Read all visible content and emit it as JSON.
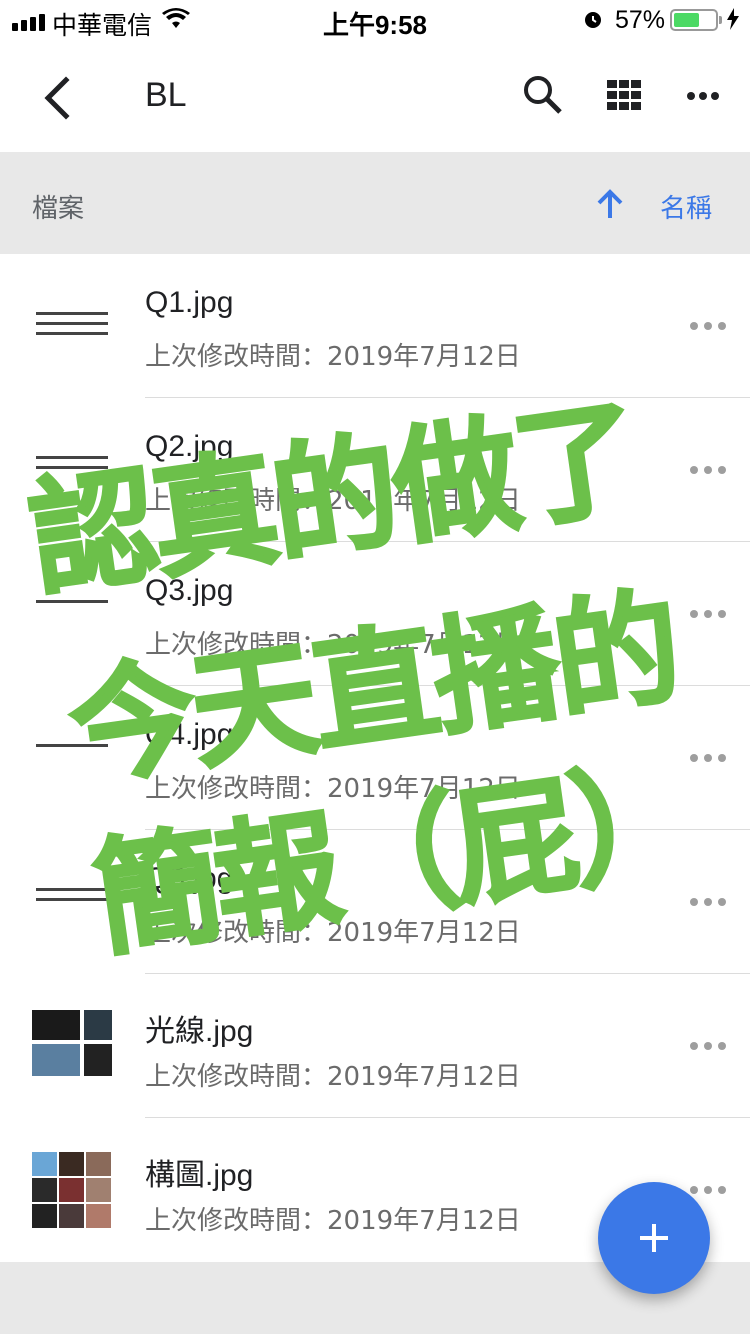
{
  "status_bar": {
    "carrier": "中華電信",
    "time": "上午9:58",
    "battery_percent_text": "57%",
    "battery_level": 0.57
  },
  "app_bar": {
    "title": "BL",
    "icons": [
      "chevron-left-icon",
      "search-icon",
      "grid-view-icon",
      "more-horizontal-icon"
    ]
  },
  "sort_bar": {
    "section_label": "檔案",
    "sort_label": "名稱",
    "sort_direction": "ascending"
  },
  "files": [
    {
      "name": "Q1.jpg",
      "modified": "上次修改時間：2019年7月12日",
      "thumb": "text-image"
    },
    {
      "name": "Q2.jpg",
      "modified": "上次修改時間：2019年7月12日",
      "thumb": "text-image"
    },
    {
      "name": "Q3.jpg",
      "modified": "上次修改時間：2019年7月12日",
      "thumb": "text-image"
    },
    {
      "name": "Q4.jpg",
      "modified": "上次修改時間：2019年7月12日",
      "thumb": "text-image"
    },
    {
      "name": "Q5.jpg",
      "modified": "上次修改時間：2019年7月12日",
      "thumb": "text-image"
    },
    {
      "name": "光線.jpg",
      "modified": "上次修改時間：2019年7月12日",
      "thumb": "photo-grid"
    },
    {
      "name": "構圖.jpg",
      "modified": "上次修改時間：2019年7月12日",
      "thumb": "photo-grid"
    }
  ],
  "fab": {
    "icon": "plus-icon"
  },
  "overlay": {
    "line1": "認真的做了",
    "line2": "今天直播的",
    "line3": "簡報（屁）",
    "color": "#6cc04a"
  },
  "colors": {
    "accent": "#3b78e7",
    "overlay": "#6cc04a",
    "battery": "#4cd964"
  }
}
